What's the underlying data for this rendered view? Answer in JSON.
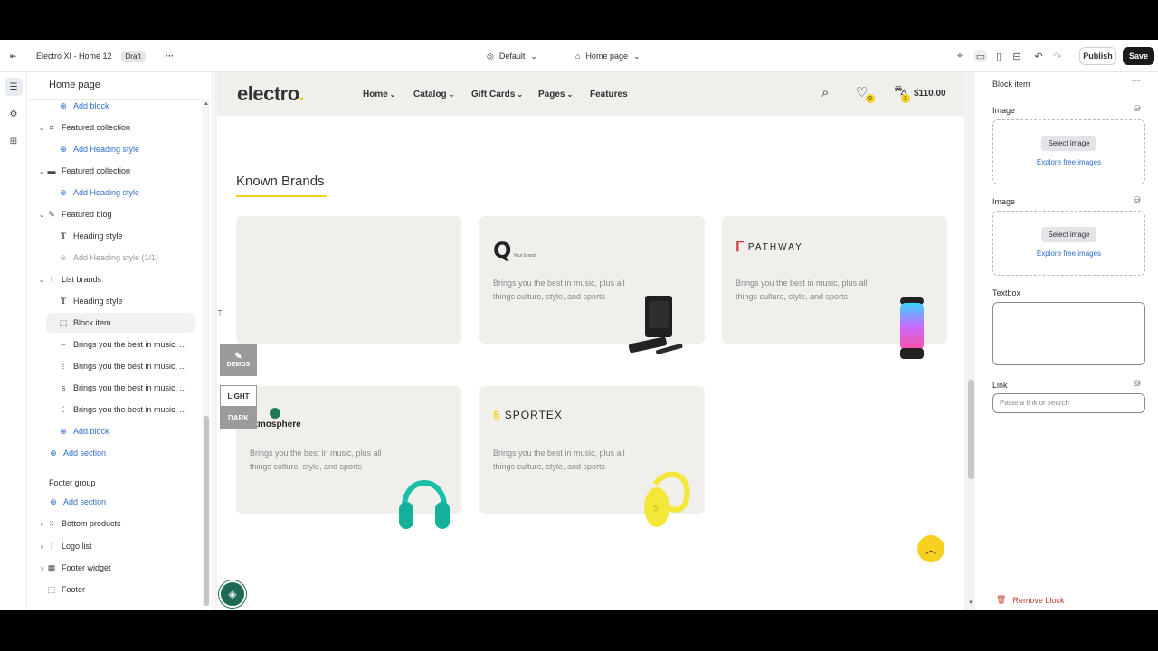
{
  "topbar": {
    "store_name": "Electro XI - Home 12",
    "status_badge": "Draft",
    "more": "···",
    "theme_select": "Default",
    "page_select": "Home page",
    "publish_label": "Publish",
    "save_label": "Save"
  },
  "left_panel": {
    "title": "Home page",
    "items": [
      {
        "label": "Add block",
        "type": "add",
        "indent": 2
      },
      {
        "label": "Featured collection",
        "type": "section",
        "indent": 1
      },
      {
        "label": "Add Heading style",
        "type": "add",
        "indent": 2
      },
      {
        "label": "Featured collection",
        "type": "section",
        "indent": 1
      },
      {
        "label": "Add Heading style",
        "type": "add",
        "indent": 2
      },
      {
        "label": "Featured blog",
        "type": "section",
        "indent": 1
      },
      {
        "label": "Heading style",
        "type": "block",
        "indent": 2
      },
      {
        "label": "Add Heading style (1/1)",
        "type": "disabled",
        "indent": 2
      },
      {
        "label": "List brands",
        "type": "section",
        "indent": 1
      },
      {
        "label": "Heading style",
        "type": "block",
        "indent": 2
      },
      {
        "label": "Block item",
        "type": "selected",
        "indent": 2
      },
      {
        "label": "Brings you the best in music, ...",
        "type": "block",
        "indent": 2
      },
      {
        "label": "Brings you the best in music, ...",
        "type": "block",
        "indent": 2
      },
      {
        "label": "Brings you the best in music, ...",
        "type": "block",
        "indent": 2
      },
      {
        "label": "Brings you the best in music, ...",
        "type": "block",
        "indent": 2
      },
      {
        "label": "Add block",
        "type": "add",
        "indent": 2
      },
      {
        "label": "Add section",
        "type": "add",
        "indent": 1
      }
    ],
    "footer_group": {
      "title": "Footer group",
      "add_section": "Add section",
      "items": [
        "Bottom products",
        "Logo list",
        "Footer widget",
        "Footer"
      ]
    }
  },
  "site": {
    "logo": "electro",
    "nav": [
      "Home",
      "Catalog",
      "Gift Cards",
      "Pages",
      "Features"
    ],
    "wishlist_count": "0",
    "cart_count": "1",
    "cart_total": "$110.00",
    "section_title": "Known Brands",
    "cards": [
      {
        "brand": "",
        "desc": ""
      },
      {
        "brand": "Q",
        "tagline": "Your brand",
        "desc": "Brings you the best in music, plus all things culture, style, and sports"
      },
      {
        "brand": "PATHWAY",
        "desc": "Brings you the best in music, plus all things culture, style, and sports"
      },
      {
        "brand": "atmosphere",
        "desc": "Brings you the best in music, plus all things culture, style, and sports"
      },
      {
        "brand": "SPORTEX",
        "desc": "Brings you the best in music, plus all things culture, style, and sports"
      }
    ],
    "demo_tab": "DEMOS",
    "light_label": "LIGHT",
    "dark_label": "DARK"
  },
  "right_panel": {
    "title": "Block item",
    "image1_label": "Image",
    "image2_label": "Image",
    "select_image": "Select image",
    "explore_images": "Explore free images",
    "textbox_label": "Textbox",
    "link_label": "Link",
    "link_placeholder": "Paste a link or search",
    "remove_block": "Remove block"
  },
  "colors": {
    "accent": "#f6d11f",
    "link_blue": "#2c6ecb",
    "card_bg": "#f1efec"
  }
}
